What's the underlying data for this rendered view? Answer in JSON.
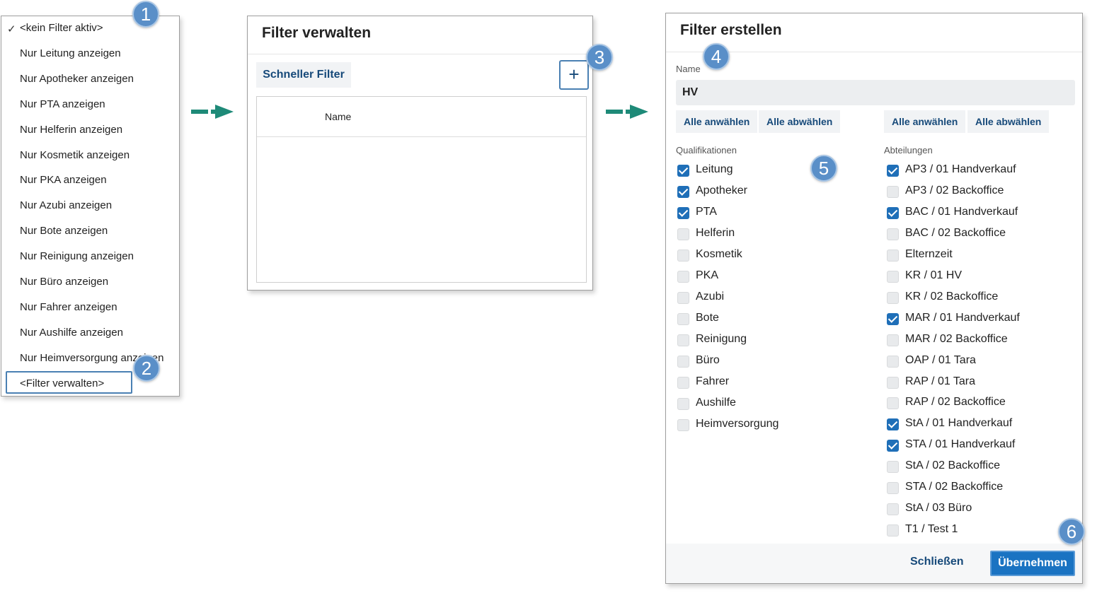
{
  "menu": {
    "check_glyph": "✓",
    "items": [
      "<kein Filter aktiv>",
      "Nur Leitung anzeigen",
      "Nur Apotheker anzeigen",
      "Nur PTA anzeigen",
      "Nur Helferin anzeigen",
      "Nur Kosmetik anzeigen",
      "Nur PKA anzeigen",
      "Nur Azubi anzeigen",
      "Nur Bote anzeigen",
      "Nur Reinigung anzeigen",
      "Nur Büro anzeigen",
      "Nur Fahrer anzeigen",
      "Nur Aushilfe anzeigen",
      "Nur Heimversorgung anzeigen",
      "<Filter verwalten>"
    ]
  },
  "badges": [
    "1",
    "2",
    "3",
    "4",
    "5",
    "6"
  ],
  "verwalten": {
    "title": "Filter verwalten",
    "tab_label": "Schneller Filter",
    "add_label": "+",
    "column_name": "Name"
  },
  "erstellen": {
    "title": "Filter erstellen",
    "name_label": "Name",
    "name_value": "HV",
    "select_all": "Alle anwählen",
    "deselect_all": "Alle abwählen",
    "qualifikationen_label": "Qualifikationen",
    "abteilungen_label": "Abteilungen",
    "qualifikationen": [
      {
        "label": "Leitung",
        "checked": true
      },
      {
        "label": "Apotheker",
        "checked": true
      },
      {
        "label": "PTA",
        "checked": true
      },
      {
        "label": "Helferin",
        "checked": false
      },
      {
        "label": "Kosmetik",
        "checked": false
      },
      {
        "label": "PKA",
        "checked": false
      },
      {
        "label": "Azubi",
        "checked": false
      },
      {
        "label": "Bote",
        "checked": false
      },
      {
        "label": "Reinigung",
        "checked": false
      },
      {
        "label": "Büro",
        "checked": false
      },
      {
        "label": "Fahrer",
        "checked": false
      },
      {
        "label": "Aushilfe",
        "checked": false
      },
      {
        "label": "Heimversorgung",
        "checked": false
      }
    ],
    "abteilungen": [
      {
        "label": "AP3 / 01 Handverkauf",
        "checked": true
      },
      {
        "label": "AP3 / 02 Backoffice",
        "checked": false
      },
      {
        "label": "BAC / 01 Handverkauf",
        "checked": true
      },
      {
        "label": "BAC / 02 Backoffice",
        "checked": false
      },
      {
        "label": "Elternzeit",
        "checked": false
      },
      {
        "label": "KR / 01 HV",
        "checked": false
      },
      {
        "label": "KR / 02 Backoffice",
        "checked": false
      },
      {
        "label": "MAR / 01 Handverkauf",
        "checked": true
      },
      {
        "label": "MAR / 02 Backoffice",
        "checked": false
      },
      {
        "label": "OAP / 01 Tara",
        "checked": false
      },
      {
        "label": "RAP / 01 Tara",
        "checked": false
      },
      {
        "label": "RAP / 02 Backoffice",
        "checked": false
      },
      {
        "label": "StA / 01 Handverkauf",
        "checked": true
      },
      {
        "label": "STA / 01 Handverkauf",
        "checked": true
      },
      {
        "label": "StA / 02 Backoffice",
        "checked": false
      },
      {
        "label": "STA / 02 Backoffice",
        "checked": false
      },
      {
        "label": "StA / 03 Büro",
        "checked": false
      },
      {
        "label": "T1 / Test 1",
        "checked": false
      }
    ],
    "close_label": "Schließen",
    "apply_label": "Übernehmen"
  },
  "colors": {
    "accent": "#1a73c2",
    "badge": "#5a8fc8",
    "arrow": "#1e8a78",
    "link": "#174a7a"
  }
}
